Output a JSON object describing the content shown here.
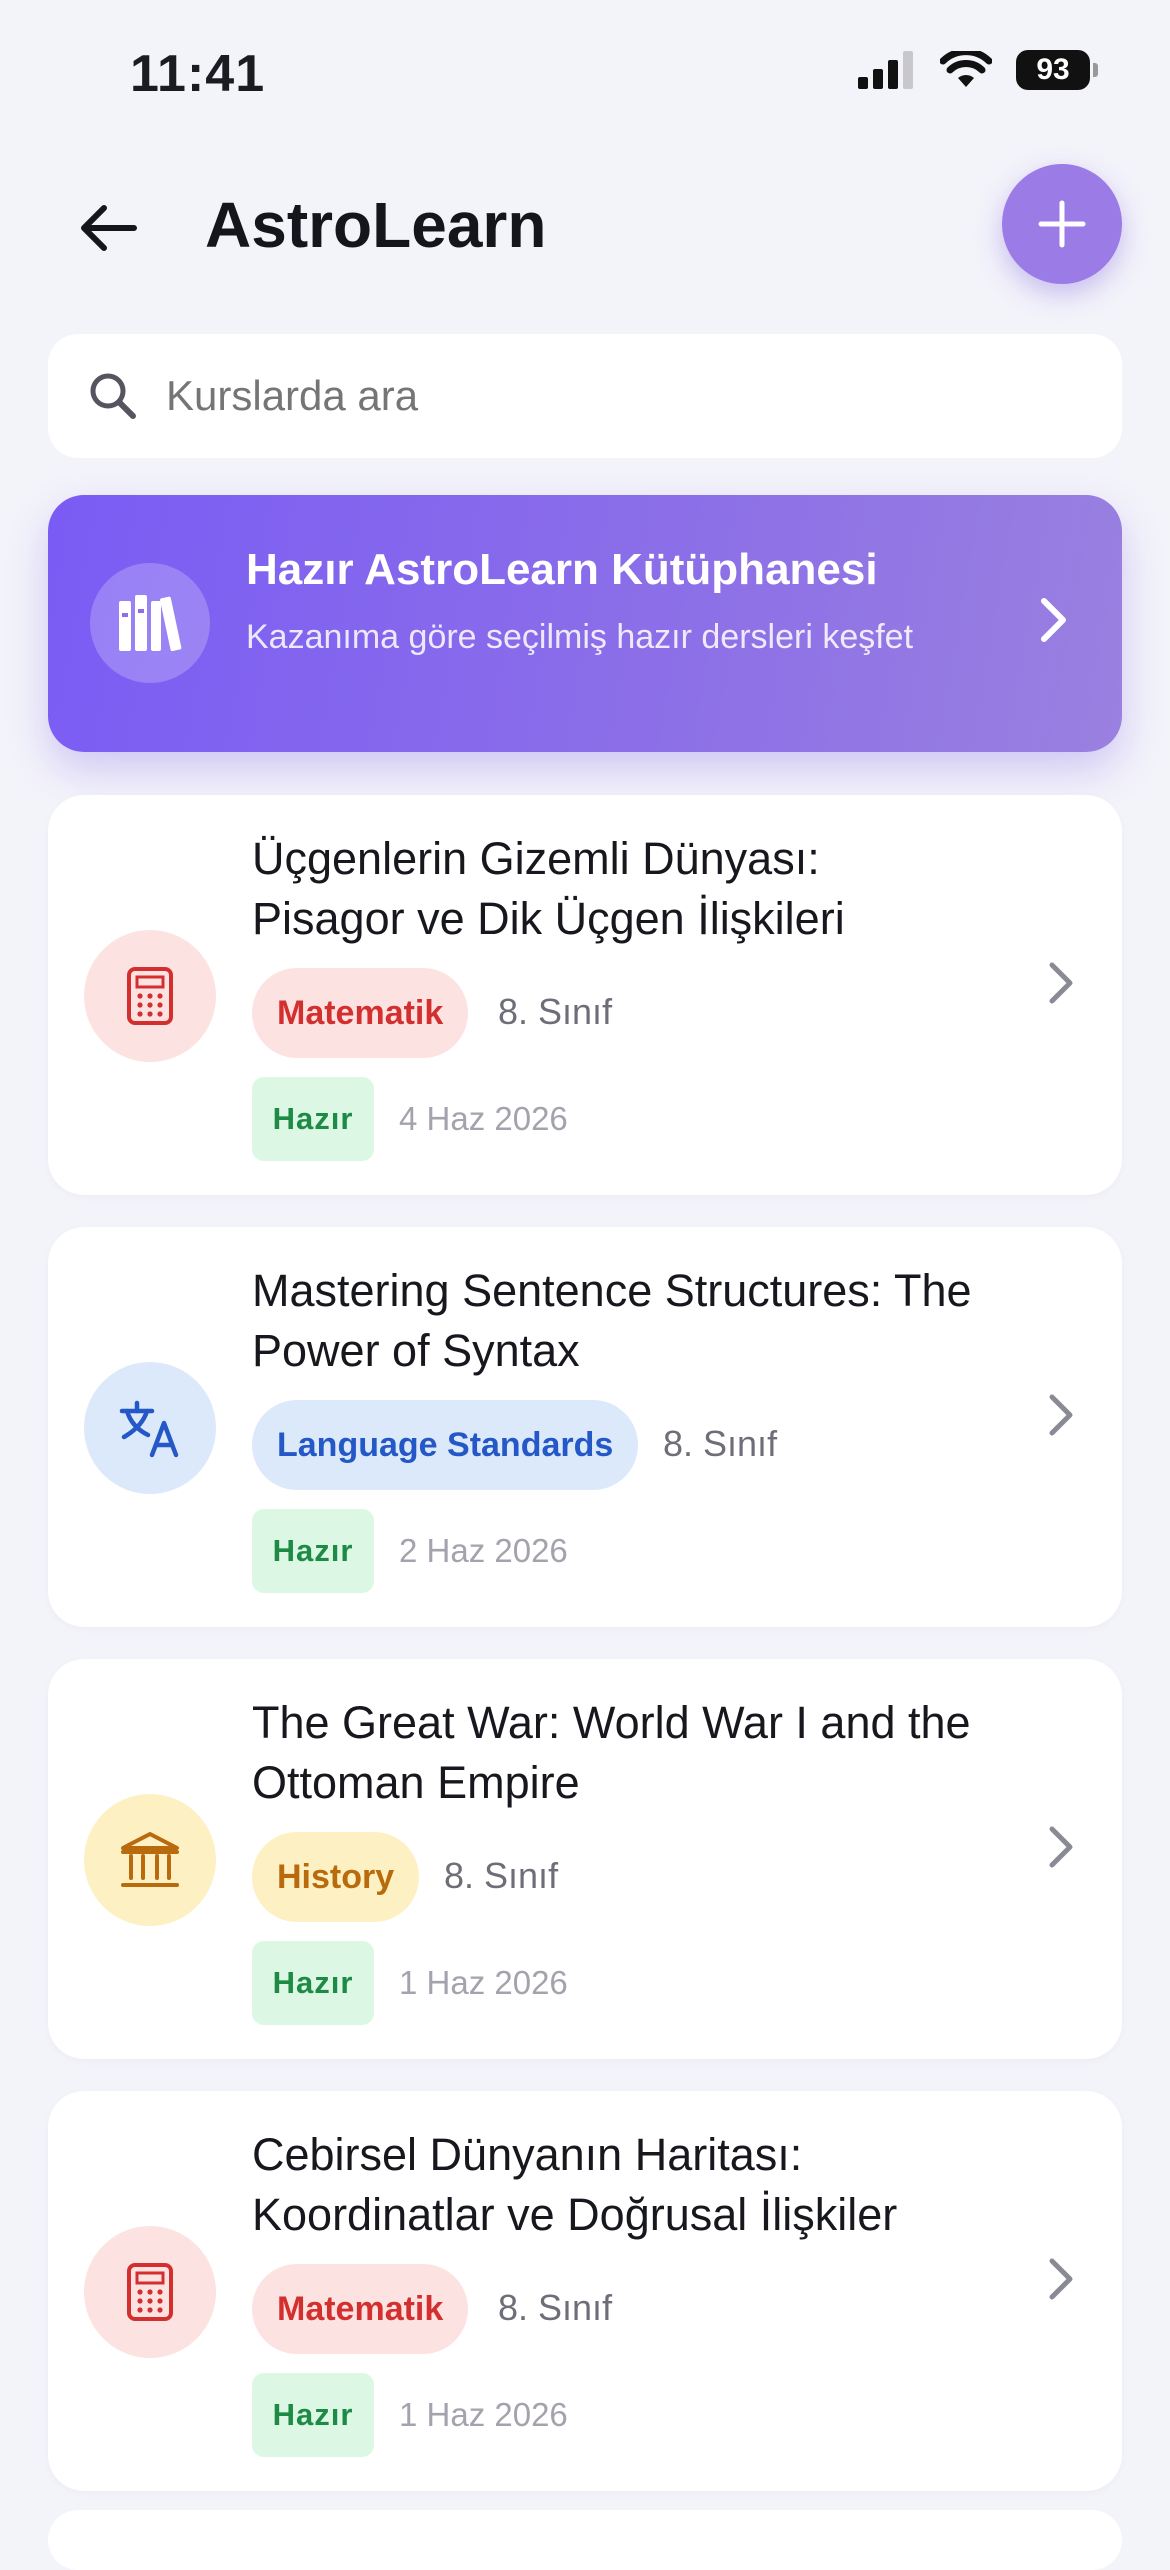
{
  "status_bar": {
    "time": "11:41",
    "battery": "93"
  },
  "header": {
    "title": "AstroLearn"
  },
  "search": {
    "placeholder": "Kurslarda ara"
  },
  "banner": {
    "title": "Hazır AstroLearn Kütüphanesi",
    "subtitle": "Kazanıma göre seçilmiş hazır dersleri keşfet"
  },
  "courses": [
    {
      "title": "Üçgenlerin Gizemli Dünyası: Pisagor ve Dik Üçgen İlişkileri",
      "subject": "Matematik",
      "grade": "8. Sınıf",
      "status": "Hazır",
      "date": "4 Haz 2026",
      "icon": "calculator-icon"
    },
    {
      "title": "Mastering Sentence Structures: The Power of Syntax",
      "subject": "Language Standards",
      "grade": "8. Sınıf",
      "status": "Hazır",
      "date": "2 Haz 2026",
      "icon": "translate-icon"
    },
    {
      "title": "The Great War: World War I and the Ottoman Empire",
      "subject": "History",
      "grade": "8. Sınıf",
      "status": "Hazır",
      "date": "1 Haz 2026",
      "icon": "museum-icon"
    },
    {
      "title": "Cebirsel Dünyanın Haritası: Koordinatlar ve Doğrusal İlişkiler",
      "subject": "Matematik",
      "grade": "8. Sınıf",
      "status": "Hazır",
      "date": "1 Haz 2026",
      "icon": "calculator-icon"
    }
  ],
  "colors": {
    "accent": "#9b7be6",
    "banner_start": "#7a5cf5",
    "math_bg": "#fde2e2",
    "math_fg": "#d32f2f",
    "language_bg": "#dce9fb",
    "language_fg": "#2458c6",
    "history_bg": "#fdf0c2",
    "history_fg": "#b86a0c",
    "ready_bg": "#dcf8e4",
    "ready_fg": "#1d8a45"
  }
}
